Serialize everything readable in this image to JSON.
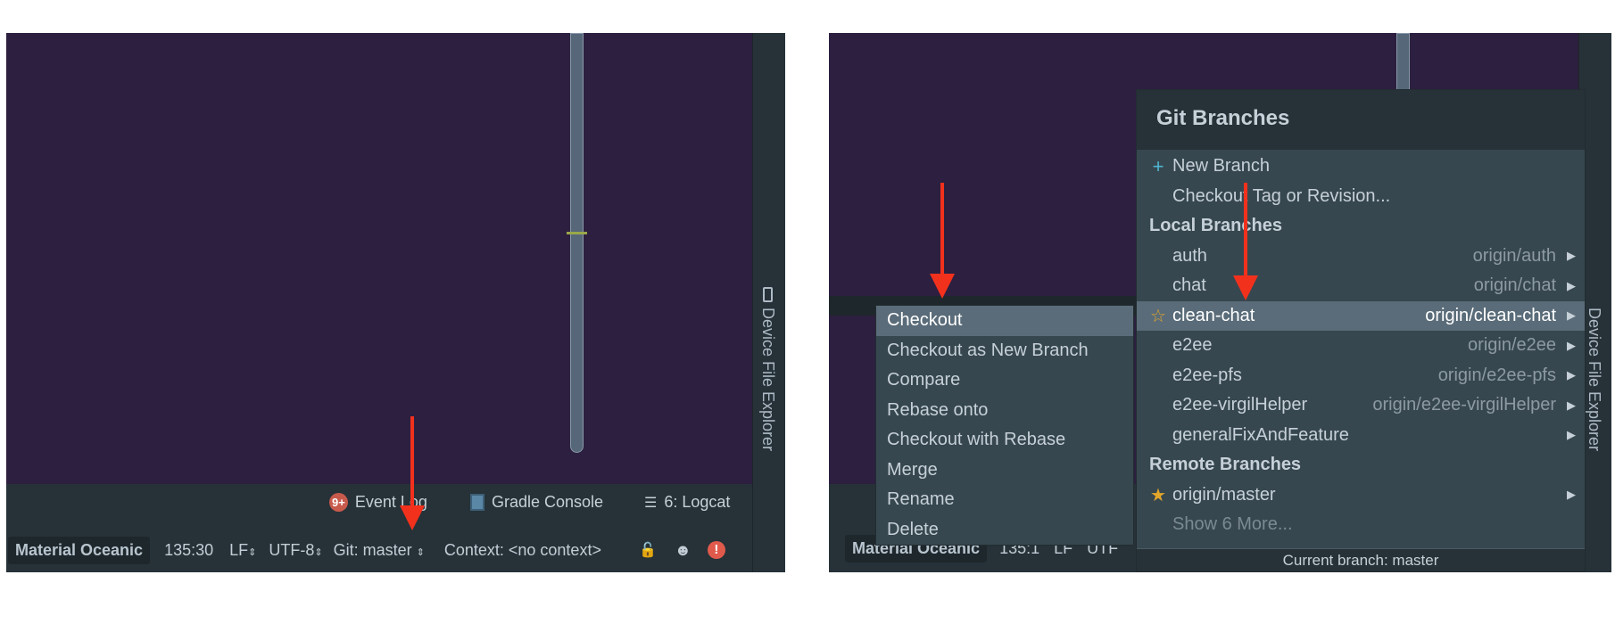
{
  "left": {
    "tool_windows": [
      {
        "label": "Event Log",
        "badge": "9+",
        "icon": "event-log-icon"
      },
      {
        "label": "Gradle Console",
        "icon": "gradle-console-icon"
      },
      {
        "label": "6: Logcat",
        "icon": "logcat-icon"
      }
    ],
    "status": {
      "theme": "Material Oceanic",
      "position": "135:30",
      "line_sep": "LF",
      "encoding": "UTF-8",
      "git": "Git: master",
      "context": "Context: <no context>"
    },
    "side_tab": "Device File Explorer"
  },
  "right": {
    "side_tab": "Device File Explorer",
    "status": {
      "theme": "Material Oceanic",
      "position": "135:1",
      "line_sep": "LF",
      "encoding": "UTF"
    },
    "popup": {
      "title": "Git Branches",
      "new_branch": "New Branch",
      "checkout_tag": "Checkout Tag or Revision...",
      "local_header": "Local Branches",
      "local": [
        {
          "name": "auth",
          "remote": "origin/auth"
        },
        {
          "name": "chat",
          "remote": "origin/chat"
        },
        {
          "name": "clean-chat",
          "remote": "origin/clean-chat",
          "selected": true
        },
        {
          "name": "e2ee",
          "remote": "origin/e2ee"
        },
        {
          "name": "e2ee-pfs",
          "remote": "origin/e2ee-pfs"
        },
        {
          "name": "e2ee-virgilHelper",
          "remote": "origin/e2ee-virgilHelper"
        },
        {
          "name": "generalFixAndFeature",
          "remote": ""
        }
      ],
      "remote_header": "Remote Branches",
      "remote": [
        {
          "name": "origin/master"
        }
      ],
      "show_more": "Show 6 More...",
      "footer": "Current branch: master"
    },
    "submenu": [
      "Checkout",
      "Checkout as New Branch",
      "Compare",
      "Rebase onto",
      "Checkout with Rebase",
      "Merge",
      "Rename",
      "Delete"
    ]
  },
  "colors": {
    "editor_bg": "#2d1f40",
    "panel_bg": "#263238",
    "popup_bg": "#37474f",
    "selection": "#5a6c79",
    "arrow": "#f2311d",
    "star": "#e2a62a",
    "plus": "#4fb6d0"
  }
}
